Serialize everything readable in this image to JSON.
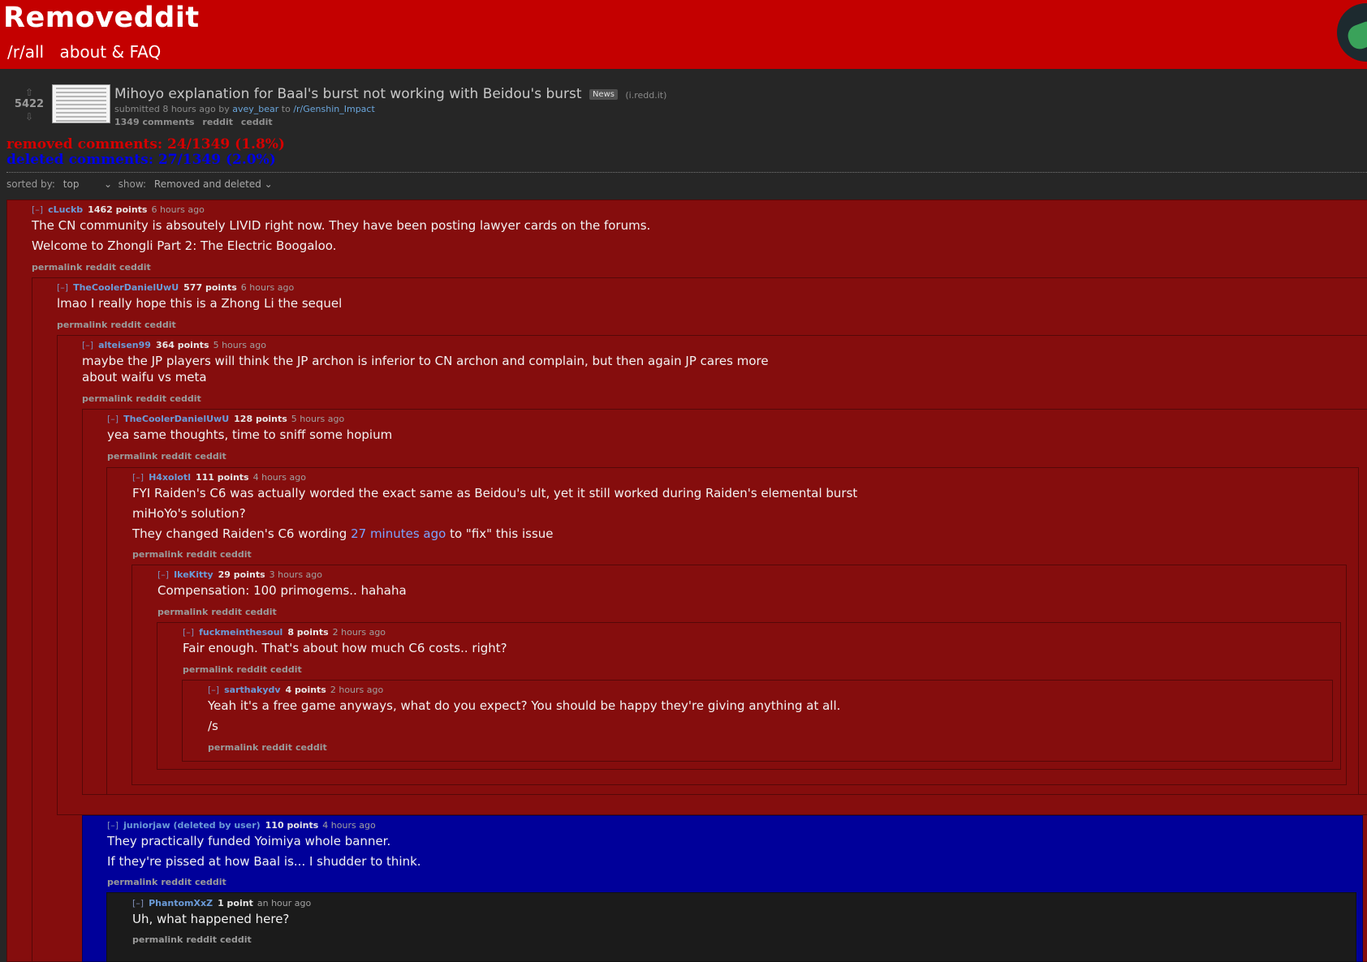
{
  "header": {
    "title": "Removeddit",
    "nav": [
      "/r/all",
      "about & FAQ"
    ]
  },
  "post": {
    "score": "5422",
    "title": "Mihoyo explanation for Baal's burst not working with Beidou's burst",
    "flair": "News",
    "domain": "(i.redd.it)",
    "submitted_prefix": "submitted",
    "submitted_time": "8 hours ago",
    "by": "by",
    "author": "avey_bear",
    "to": "to",
    "subreddit": "/r/Genshin_Impact",
    "comments_count": "1349 comments",
    "reddit_link": "reddit",
    "ceddit_link": "ceddit"
  },
  "stats": {
    "removed": "removed comments: 24/1349 (1.8%)",
    "deleted": "deleted comments: 27/1349 (2.0%)"
  },
  "controls": {
    "sorted_label": "sorted by:",
    "sorted_value": "top",
    "show_label": "show:",
    "show_value": "Removed and deleted"
  },
  "comment_links": {
    "permalink": "permalink",
    "reddit": "reddit",
    "ceddit": "ceddit",
    "toggle": "[–]"
  },
  "comments": [
    {
      "user": "cLuckb",
      "points": "1462 points",
      "age": "6 hours ago",
      "lines": [
        "The CN community is absoutely LIVID right now. They have been posting lawyer cards on the forums.",
        "Welcome to Zhongli Part 2: The Electric Boogaloo."
      ]
    },
    {
      "user": "TheCoolerDanielUwU",
      "points": "577 points",
      "age": "6 hours ago",
      "lines": [
        "lmao I really hope this is a Zhong Li the sequel"
      ]
    },
    {
      "user": "alteisen99",
      "points": "364 points",
      "age": "5 hours ago",
      "lines": [
        "maybe the JP players will think the JP archon is inferior to CN archon and complain, but then again JP cares more",
        "about waifu vs meta"
      ]
    },
    {
      "user": "TheCoolerDanielUwU",
      "points": "128 points",
      "age": "5 hours ago",
      "lines": [
        "yea same thoughts, time to sniff some hopium"
      ]
    },
    {
      "user": "H4xolotl",
      "points": "111 points",
      "age": "4 hours ago",
      "lines": [
        "FYI Raiden's C6 was actually worded the exact same as Beidou's ult, yet it still worked during Raiden's elemental burst",
        "miHoYo's solution?"
      ],
      "last_pre": "They changed Raiden's C6 wording",
      "last_link": "27 minutes ago",
      "last_post": "to \"fix\" this issue"
    },
    {
      "user": "IkeKitty",
      "points": "29 points",
      "age": "3 hours ago",
      "lines": [
        "Compensation: 100 primogems.. hahaha"
      ]
    },
    {
      "user": "fuckmeinthesoul",
      "points": "8 points",
      "age": "2 hours ago",
      "lines": [
        "Fair enough. That's about how much C6 costs.. right?"
      ]
    },
    {
      "user": "sarthakydv",
      "points": "4 points",
      "age": "2 hours ago",
      "lines": [
        "Yeah it's a free game anyways, what do you expect? You should be happy they're giving anything at all.",
        "/s"
      ]
    },
    {
      "user": "juniorjaw (deleted by user)",
      "points": "110 points",
      "age": "4 hours ago",
      "lines": [
        "They practically funded Yoimiya whole banner.",
        "If they're pissed at how Baal is... I shudder to think."
      ]
    },
    {
      "user": "PhantomXxZ",
      "points": "1 point",
      "age": "an hour ago",
      "lines": [
        "Uh, what happened here?"
      ]
    }
  ],
  "colors": {
    "header": "#c40000",
    "removed_bg": "#850d0d",
    "deleted_bg": "#00009a",
    "removed_text": "#d40000",
    "deleted_text": "#0000e6"
  },
  "icons": [
    "upvote-arrow-icon",
    "downvote-arrow-icon",
    "chevron-down-icon",
    "mascot-avatar-icon"
  ]
}
